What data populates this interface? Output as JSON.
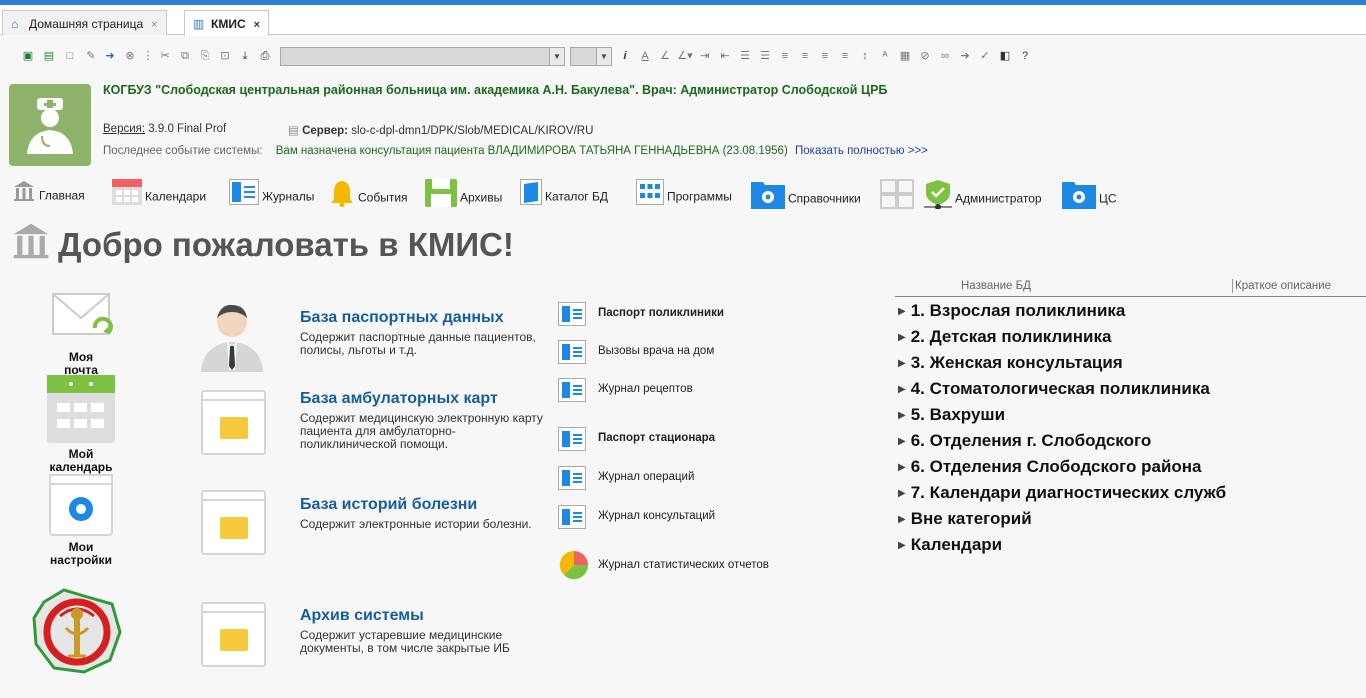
{
  "tabs": [
    {
      "label": "Домашняя страница",
      "close": "×"
    },
    {
      "label": "КМИС",
      "close": "×"
    }
  ],
  "header": {
    "org_title": "КОГБУЗ \"Слободская центральная районная больница им. академика А.Н. Бакулева\". Врач: Администратор Слободской ЦРБ",
    "version_label": "Версия:",
    "version_value": "3.9.0 Final Prof",
    "server_label": "Сервер:",
    "server_value": "slo-c-dpl-dmn1/DPK/Slob/MEDICAL/KIROV/RU",
    "event_label": "Последнее событие системы:",
    "event_msg": "Вам назначена консультация пациента ВЛАДИМИРОВА ТАТЬЯНА ГЕННАДЬЕВНА (23.08.1956)",
    "event_more": "Показать полностью >>>"
  },
  "nav": [
    {
      "label": "Главная"
    },
    {
      "label": "Календари"
    },
    {
      "label": "Журналы"
    },
    {
      "label": "События"
    },
    {
      "label": "Архивы"
    },
    {
      "label": "Каталог БД"
    },
    {
      "label": "Программы"
    },
    {
      "label": "Справочники"
    },
    {
      "label": "Администратор"
    },
    {
      "label": "ЦС"
    }
  ],
  "welcome": "Добро пожаловать в КМИС!",
  "sidebar": [
    {
      "label": "Моя почта"
    },
    {
      "label": "Мой календарь"
    },
    {
      "label": "Мои настройки"
    }
  ],
  "databases": [
    {
      "title": "База паспортных данных",
      "desc": "Содержит паспортные данные пациентов, полисы, льготы и т.д."
    },
    {
      "title": "База амбулаторных карт",
      "desc": "Содержит медицинскую электронную карту пациента для амбулаторно-поликлинической помощи."
    },
    {
      "title": "База историй болезни",
      "desc": "Содержит электронные истории болезни."
    },
    {
      "title": "Архив системы",
      "desc": "Содержит устаревшие медицинские документы, в том числе закрытые ИБ"
    }
  ],
  "journals": [
    {
      "label": "Паспорт поликлиники"
    },
    {
      "label": "Вызовы врача на дом"
    },
    {
      "label": "Журнал рецептов"
    },
    {
      "label": "Паспорт стационара"
    },
    {
      "label": "Журнал операций"
    },
    {
      "label": "Журнал консультаций"
    },
    {
      "label": "Журнал статистических отчетов"
    }
  ],
  "tree": {
    "col_name": "Название БД",
    "col_desc": "Краткое описание",
    "items": [
      {
        "label": "1. Взрослая поликлиника"
      },
      {
        "label": "2. Детская поликлиника"
      },
      {
        "label": "3. Женская консультация"
      },
      {
        "label": "4. Стоматологическая поликлиника"
      },
      {
        "label": "5. Вахруши"
      },
      {
        "label": "6. Отделения г. Слободского"
      },
      {
        "label": "6. Отделения Слободского района"
      },
      {
        "label": "7. Календари диагностических служб"
      },
      {
        "label": "Вне категорий"
      },
      {
        "label": "Календари"
      }
    ]
  },
  "colors": {
    "accent": "#2f7fd0",
    "green_text": "#1a6b1a",
    "link_blue": "#155e9c",
    "folder": "#f5c93c"
  }
}
